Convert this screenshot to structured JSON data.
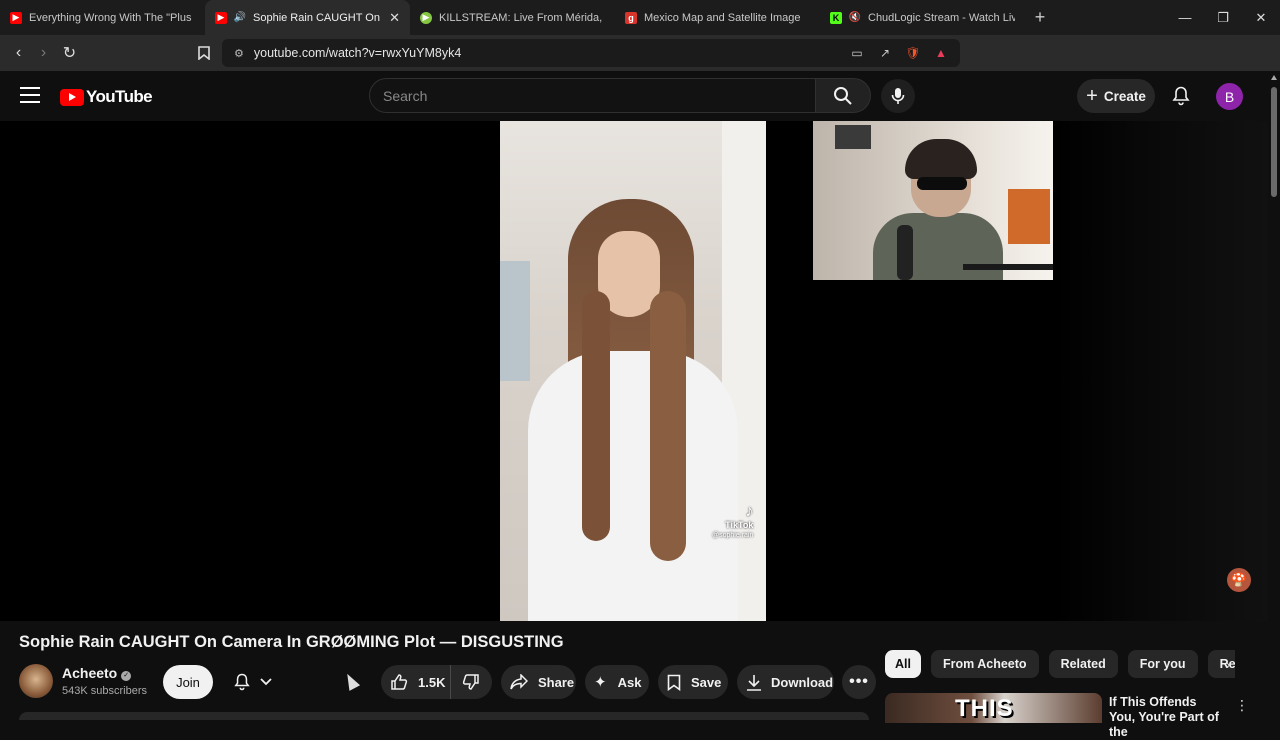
{
  "browser": {
    "tabs": [
      {
        "title": "Everything Wrong With The \"Plus Size",
        "icon": "youtube-icon",
        "active": false
      },
      {
        "title": "Sophie Rain CAUGHT On Cam",
        "icon": "youtube-icon",
        "active": true
      },
      {
        "title": "KILLSTREAM: Live From Mérida, Mexi",
        "icon": "rumble-icon",
        "active": false
      },
      {
        "title": "Mexico Map and Satellite Image",
        "icon": "site-g-icon",
        "active": false
      },
      {
        "title": "ChudLogic Stream - Watch Live o",
        "icon": "kick-icon",
        "active": false
      }
    ],
    "url": "youtube.com/watch?v=rwxYuYM8yk4"
  },
  "youtube": {
    "logo_text": "YouTube",
    "search_placeholder": "Search",
    "create_label": "Create",
    "avatar_letter": "B"
  },
  "video": {
    "title": "Sophie Rain CAUGHT On Camera In GRØØMING Plot — DISGUSTING",
    "overlay_brand": "TikTok",
    "overlay_handle": "@sophie.rain",
    "channel_name": "Acheeto",
    "subscribers": "543K subscribers",
    "join_label": "Join",
    "likes": "1.5K",
    "share_label": "Share",
    "ask_label": "Ask",
    "save_label": "Save",
    "download_label": "Download"
  },
  "sidebar": {
    "chips": [
      "All",
      "From Acheeto",
      "Related",
      "For you",
      "Recent"
    ],
    "recommended": {
      "thumb_text": "THIS",
      "title": "If This Offends You, You're Part of the"
    }
  },
  "colors": {
    "youtube_red": "#ff0000",
    "background": "#0f0f0f",
    "chip_bg": "#272727",
    "avatar_bg": "#8e24aa"
  }
}
